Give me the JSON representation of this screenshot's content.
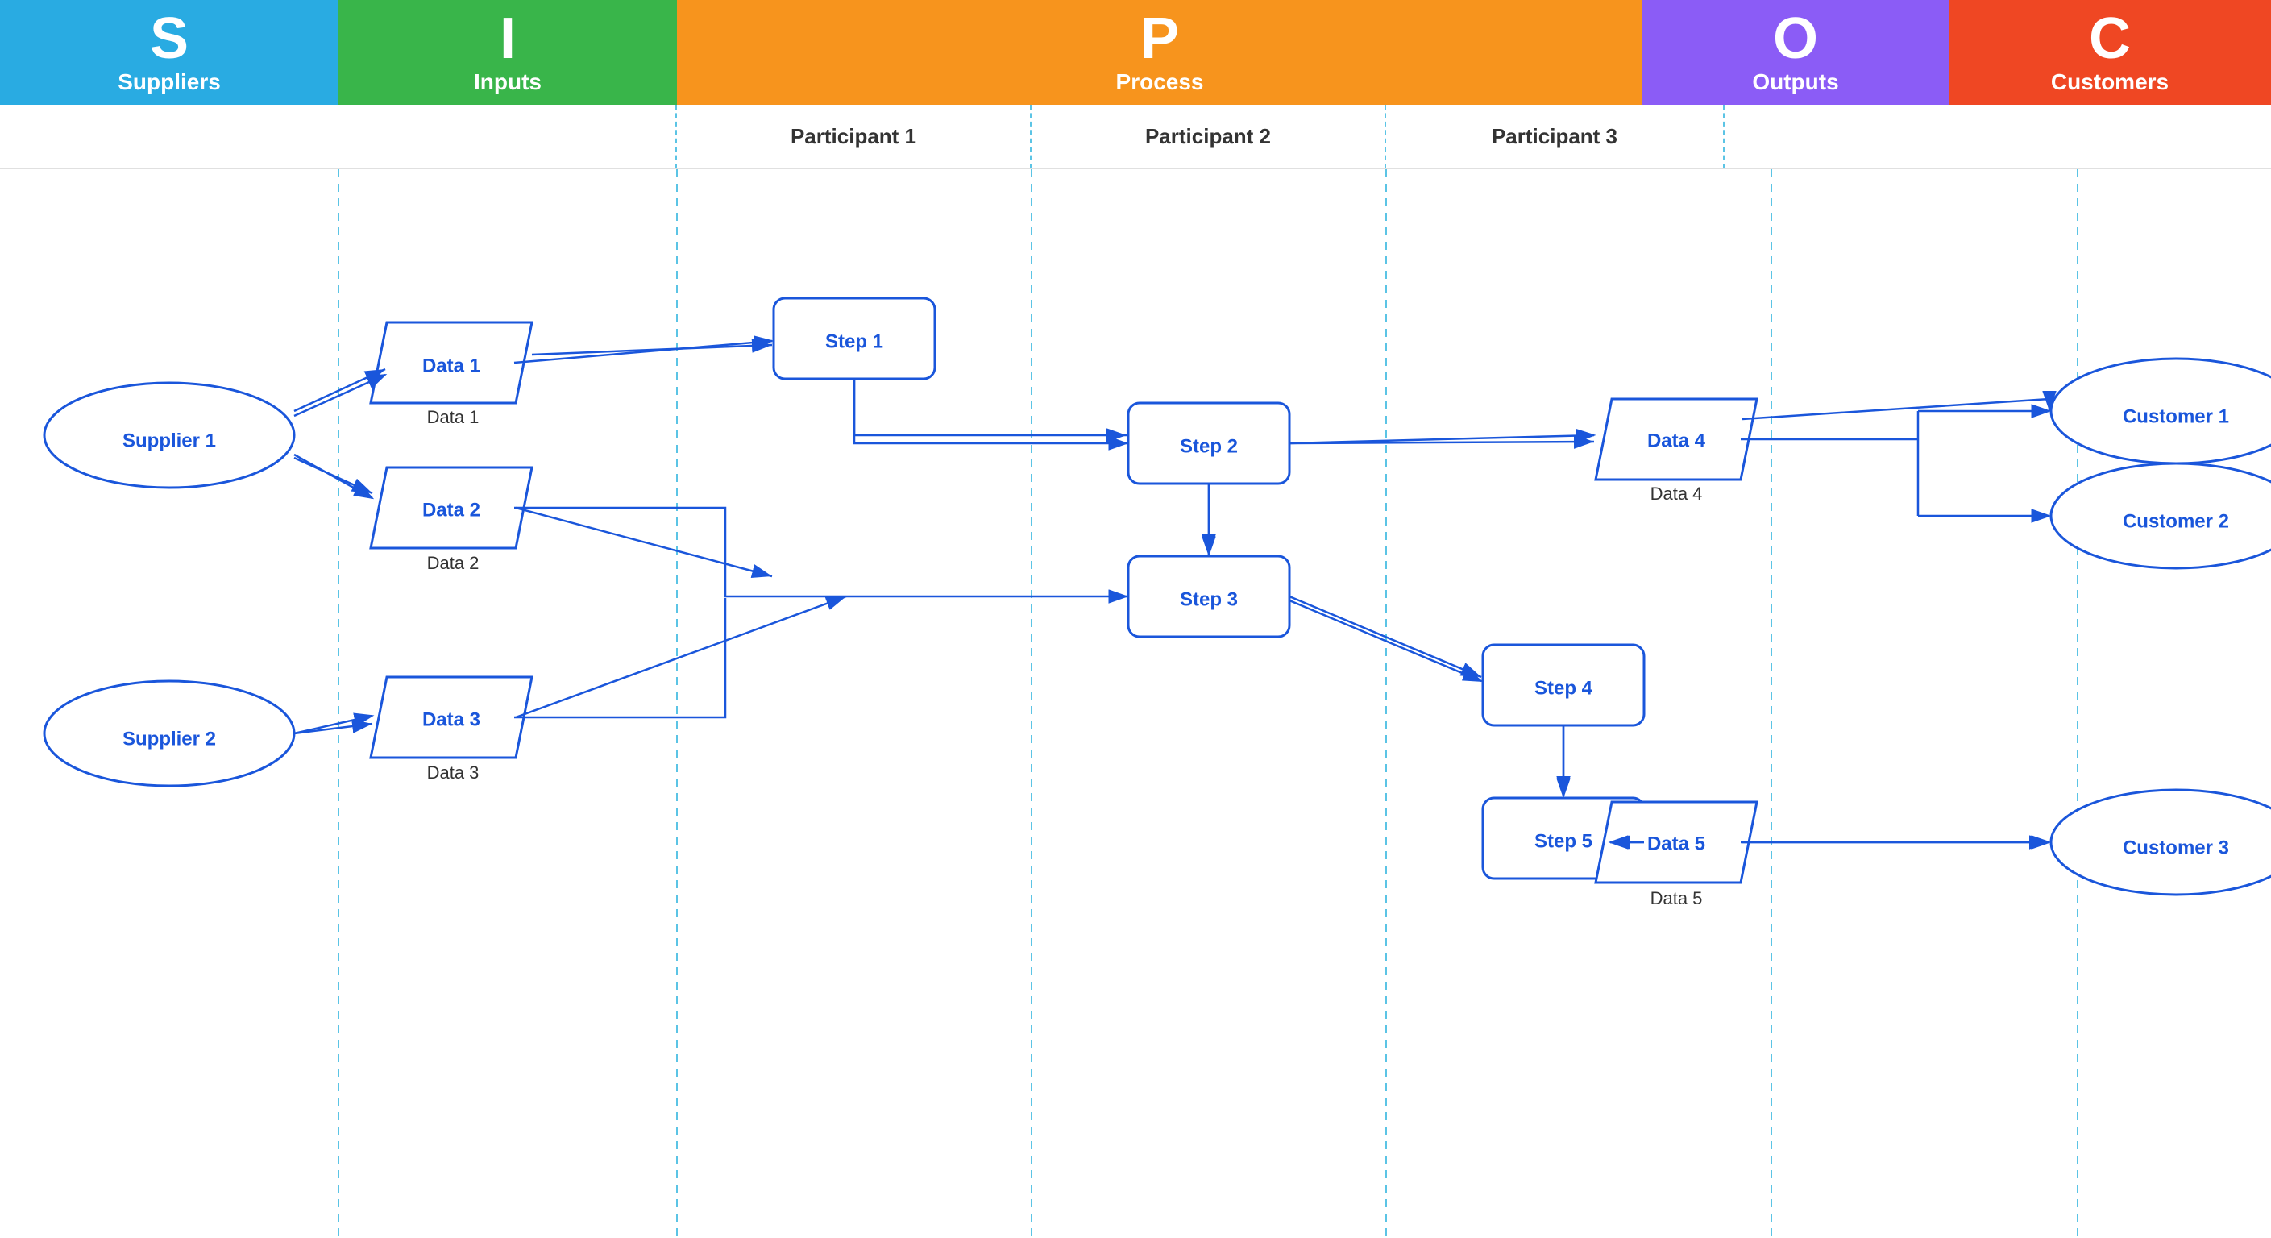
{
  "header": {
    "columns": [
      {
        "id": "S",
        "letter": "S",
        "label": "Suppliers",
        "color": "#29ABE2"
      },
      {
        "id": "I",
        "letter": "I",
        "label": "Inputs",
        "color": "#39B54A"
      },
      {
        "id": "P",
        "letter": "P",
        "label": "Process",
        "color": "#F7941D"
      },
      {
        "id": "O",
        "letter": "O",
        "label": "Outputs",
        "color": "#8B5CF6"
      },
      {
        "id": "C",
        "letter": "C",
        "label": "Customers",
        "color": "#EF4723"
      }
    ]
  },
  "participants": [
    {
      "label": "Participant 1"
    },
    {
      "label": "Participant 2"
    },
    {
      "label": "Participant 3"
    }
  ],
  "nodes": {
    "suppliers": [
      {
        "id": "supplier1",
        "label": "Supplier 1"
      },
      {
        "id": "supplier2",
        "label": "Supplier 2"
      }
    ],
    "inputs": [
      {
        "id": "data1",
        "label": "Data 1"
      },
      {
        "id": "data2",
        "label": "Data 2"
      },
      {
        "id": "data3",
        "label": "Data 3"
      }
    ],
    "process": [
      {
        "id": "step1",
        "label": "Step 1"
      },
      {
        "id": "step2",
        "label": "Step 2"
      },
      {
        "id": "step3",
        "label": "Step 3"
      },
      {
        "id": "step4",
        "label": "Step 4"
      },
      {
        "id": "step5",
        "label": "Step 5"
      }
    ],
    "outputs": [
      {
        "id": "data4",
        "label": "Data 4"
      },
      {
        "id": "data5",
        "label": "Data 5"
      }
    ],
    "customers": [
      {
        "id": "customer1",
        "label": "Customer 1"
      },
      {
        "id": "customer2",
        "label": "Customer 2"
      },
      {
        "id": "customer3",
        "label": "Customer 3"
      }
    ]
  }
}
